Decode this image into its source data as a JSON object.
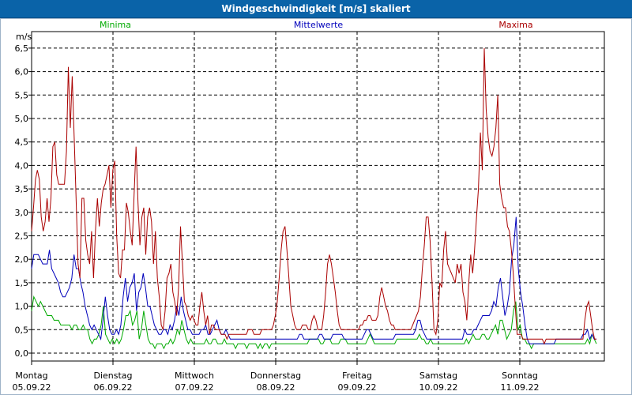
{
  "window": {
    "title": "Windgeschwindigkeit [m/s] skaliert"
  },
  "chart_data": {
    "type": "line",
    "title": "Windgeschwindigkeit [m/s] skaliert",
    "ylabel": "m/s",
    "ylim": [
      -0.15,
      6.7
    ],
    "y_ticks": [
      "0,0",
      "0,5",
      "1,0",
      "1,5",
      "2,0",
      "2,5",
      "3,0",
      "3,5",
      "4,0",
      "4,5",
      "5,0",
      "5,5",
      "6,0",
      "6,5"
    ],
    "y_tick_values": [
      0,
      0.5,
      1,
      1.5,
      2,
      2.5,
      3,
      3.5,
      4,
      4.5,
      5,
      5.5,
      6,
      6.5
    ],
    "x_categories": [
      {
        "day": "Montag",
        "date": "05.09.22"
      },
      {
        "day": "Dienstag",
        "date": "06.09.22"
      },
      {
        "day": "Mittwoch",
        "date": "07.09.22"
      },
      {
        "day": "Donnerstag",
        "date": "08.09.22"
      },
      {
        "day": "Freitag",
        "date": "09.09.22"
      },
      {
        "day": "Samstag",
        "date": "10.09.22"
      },
      {
        "day": "Sonntag",
        "date": "11.09.22"
      }
    ],
    "grid": true,
    "legend_position": "top",
    "series": [
      {
        "name": "Minima",
        "color": "#00aa00",
        "values": [
          0.9,
          1.2,
          1.1,
          1.0,
          1.1,
          1.0,
          0.9,
          0.8,
          0.8,
          0.8,
          0.7,
          0.7,
          0.7,
          0.6,
          0.6,
          0.6,
          0.6,
          0.6,
          0.5,
          0.6,
          0.6,
          0.5,
          0.5,
          0.6,
          0.5,
          0.5,
          0.3,
          0.2,
          0.3,
          0.3,
          0.4,
          0.6,
          1.0,
          0.4,
          0.3,
          0.2,
          0.3,
          0.2,
          0.3,
          0.2,
          0.3,
          0.5,
          0.8,
          0.8,
          0.9,
          0.6,
          0.7,
          0.9,
          0.3,
          0.5,
          0.9,
          0.6,
          0.3,
          0.2,
          0.2,
          0.1,
          0.2,
          0.2,
          0.2,
          0.1,
          0.2,
          0.2,
          0.3,
          0.2,
          0.3,
          0.5,
          0.4,
          0.7,
          0.5,
          0.3,
          0.2,
          0.3,
          0.2,
          0.2,
          0.2,
          0.2,
          0.2,
          0.2,
          0.3,
          0.2,
          0.2,
          0.3,
          0.3,
          0.2,
          0.2,
          0.2,
          0.3,
          0.2,
          0.2,
          0.2,
          0.2,
          0.1,
          0.2,
          0.2,
          0.2,
          0.2,
          0.1,
          0.2,
          0.2,
          0.2,
          0.2,
          0.1,
          0.2,
          0.1,
          0.2,
          0.2,
          0.1,
          0.2,
          0.2,
          0.2,
          0.2,
          0.2,
          0.2,
          0.2,
          0.2,
          0.2,
          0.2,
          0.2,
          0.2,
          0.2,
          0.2,
          0.2,
          0.2,
          0.2,
          0.3,
          0.3,
          0.3,
          0.3,
          0.3,
          0.2,
          0.2,
          0.3,
          0.3,
          0.3,
          0.2,
          0.2,
          0.2,
          0.2,
          0.3,
          0.3,
          0.3,
          0.2,
          0.2,
          0.2,
          0.2,
          0.2,
          0.2,
          0.2,
          0.2,
          0.2,
          0.3,
          0.4,
          0.3,
          0.2,
          0.2,
          0.2,
          0.2,
          0.2,
          0.2,
          0.2,
          0.2,
          0.2,
          0.2,
          0.3,
          0.3,
          0.3,
          0.3,
          0.3,
          0.3,
          0.3,
          0.3,
          0.3,
          0.3,
          0.4,
          0.3,
          0.3,
          0.2,
          0.2,
          0.3,
          0.2,
          0.2,
          0.2,
          0.2,
          0.2,
          0.2,
          0.2,
          0.2,
          0.2,
          0.2,
          0.2,
          0.2,
          0.2,
          0.2,
          0.2,
          0.3,
          0.2,
          0.3,
          0.4,
          0.3,
          0.3,
          0.3,
          0.4,
          0.4,
          0.3,
          0.3,
          0.4,
          0.5,
          0.6,
          0.4,
          0.7,
          0.7,
          0.5,
          0.3,
          0.4,
          0.5,
          0.9,
          1.1,
          0.5,
          0.6,
          0.3,
          0.3,
          0.2,
          0.2,
          0.1,
          0.2,
          0.2,
          0.2,
          0.2,
          0.2,
          0.2,
          0.2,
          0.2,
          0.2,
          0.2,
          0.2,
          0.2,
          0.2,
          0.2,
          0.2,
          0.2,
          0.2,
          0.2,
          0.2,
          0.2,
          0.2,
          0.2,
          0.2,
          0.2,
          0.3,
          0.2,
          0.4,
          0.3,
          0.2
        ]
      },
      {
        "name": "Mittelwerte",
        "color": "#0000bb",
        "values": [
          1.8,
          2.1,
          2.1,
          2.1,
          2.0,
          1.9,
          1.9,
          1.9,
          2.2,
          1.8,
          1.7,
          1.6,
          1.5,
          1.3,
          1.2,
          1.2,
          1.3,
          1.4,
          1.6,
          2.1,
          1.8,
          1.8,
          1.5,
          1.3,
          1.0,
          0.8,
          0.6,
          0.5,
          0.6,
          0.5,
          0.4,
          0.3,
          0.7,
          1.2,
          0.8,
          0.5,
          0.4,
          0.4,
          0.5,
          0.4,
          0.6,
          1.2,
          1.6,
          1.1,
          1.4,
          1.5,
          1.7,
          0.9,
          1.3,
          1.4,
          1.7,
          1.4,
          1.0,
          1.0,
          0.8,
          0.6,
          0.5,
          0.4,
          0.4,
          0.5,
          0.5,
          0.4,
          0.6,
          0.5,
          0.7,
          1.0,
          0.8,
          1.2,
          0.9,
          0.7,
          0.5,
          0.5,
          0.4,
          0.4,
          0.4,
          0.4,
          0.5,
          0.5,
          0.6,
          0.4,
          0.4,
          0.5,
          0.6,
          0.7,
          0.5,
          0.4,
          0.4,
          0.5,
          0.4,
          0.3,
          0.3,
          0.3,
          0.3,
          0.3,
          0.3,
          0.3,
          0.3,
          0.3,
          0.3,
          0.3,
          0.3,
          0.3,
          0.3,
          0.3,
          0.3,
          0.3,
          0.3,
          0.3,
          0.3,
          0.3,
          0.3,
          0.3,
          0.3,
          0.3,
          0.3,
          0.3,
          0.3,
          0.3,
          0.3,
          0.3,
          0.4,
          0.4,
          0.3,
          0.3,
          0.3,
          0.3,
          0.3,
          0.3,
          0.3,
          0.4,
          0.4,
          0.3,
          0.3,
          0.3,
          0.3,
          0.4,
          0.4,
          0.4,
          0.4,
          0.4,
          0.3,
          0.3,
          0.3,
          0.3,
          0.3,
          0.3,
          0.3,
          0.3,
          0.3,
          0.4,
          0.5,
          0.5,
          0.4,
          0.3,
          0.3,
          0.3,
          0.3,
          0.3,
          0.3,
          0.3,
          0.3,
          0.3,
          0.3,
          0.4,
          0.4,
          0.4,
          0.4,
          0.4,
          0.4,
          0.4,
          0.4,
          0.4,
          0.5,
          0.7,
          0.7,
          0.5,
          0.4,
          0.3,
          0.3,
          0.3,
          0.3,
          0.3,
          0.3,
          0.3,
          0.3,
          0.3,
          0.3,
          0.3,
          0.3,
          0.3,
          0.3,
          0.3,
          0.3,
          0.3,
          0.5,
          0.4,
          0.4,
          0.4,
          0.5,
          0.5,
          0.6,
          0.7,
          0.8,
          0.8,
          0.8,
          0.8,
          0.9,
          1.1,
          1.0,
          1.4,
          1.6,
          1.2,
          0.8,
          1.0,
          1.3,
          2.0,
          2.3,
          2.9,
          1.8,
          1.3,
          1.0,
          0.6,
          0.3,
          0.2,
          0.2,
          0.2,
          0.2,
          0.2,
          0.2,
          0.2,
          0.2,
          0.2,
          0.2,
          0.2,
          0.2,
          0.3,
          0.3,
          0.3,
          0.3,
          0.3,
          0.3,
          0.3,
          0.3,
          0.3,
          0.3,
          0.3,
          0.3,
          0.4,
          0.4,
          0.5,
          0.3,
          0.4,
          0.3,
          0.3
        ]
      },
      {
        "name": "Maxima",
        "color": "#aa0000",
        "values": [
          2.6,
          3.1,
          3.7,
          3.9,
          3.7,
          2.9,
          2.6,
          2.8,
          3.3,
          2.8,
          3.3,
          4.4,
          4.5,
          3.8,
          3.6,
          3.6,
          3.6,
          3.6,
          4.3,
          6.1,
          4.8,
          5.9,
          4.6,
          3.3,
          1.9,
          1.6,
          3.3,
          3.3,
          2.4,
          2.1,
          1.9,
          2.6,
          1.6,
          2.6,
          3.3,
          2.7,
          3.2,
          3.5,
          3.6,
          3.8,
          4.0,
          3.1,
          3.9,
          4.1,
          2.5,
          1.7,
          1.6,
          2.2,
          2.2,
          3.2,
          3.0,
          2.6,
          2.3,
          3.4,
          4.4,
          3.2,
          2.3,
          2.9,
          3.1,
          2.1,
          2.9,
          3.1,
          2.8,
          1.9,
          2.6,
          1.6,
          1.2,
          0.6,
          0.5,
          0.9,
          1.6,
          1.7,
          1.9,
          1.3,
          1.1,
          0.8,
          1.4,
          2.7,
          1.9,
          1.1,
          1.0,
          0.8,
          0.7,
          0.8,
          0.7,
          0.6,
          0.6,
          1.0,
          1.3,
          0.9,
          0.6,
          0.8,
          0.4,
          0.6,
          0.6,
          0.5,
          0.5,
          0.5,
          0.4,
          0.4,
          0.4,
          0.3,
          0.4,
          0.4,
          0.4,
          0.4,
          0.4,
          0.4,
          0.4,
          0.4,
          0.4,
          0.4,
          0.5,
          0.5,
          0.5,
          0.4,
          0.4,
          0.4,
          0.4,
          0.5,
          0.5,
          0.5,
          0.5,
          0.5,
          0.5,
          0.6,
          0.8,
          1.1,
          1.6,
          2.2,
          2.6,
          2.7,
          2.2,
          1.6,
          1.0,
          0.8,
          0.6,
          0.5,
          0.5,
          0.5,
          0.6,
          0.6,
          0.6,
          0.5,
          0.5,
          0.7,
          0.8,
          0.7,
          0.5,
          0.5,
          0.5,
          0.8,
          1.3,
          1.9,
          2.1,
          1.9,
          1.6,
          1.3,
          0.9,
          0.6,
          0.5,
          0.5,
          0.5,
          0.5,
          0.5,
          0.5,
          0.5,
          0.5,
          0.5,
          0.5,
          0.6,
          0.6,
          0.7,
          0.7,
          0.8,
          0.8,
          0.7,
          0.7,
          0.7,
          0.8,
          1.2,
          1.4,
          1.2,
          1.0,
          0.9,
          0.7,
          0.6,
          0.6,
          0.5,
          0.5,
          0.5,
          0.5,
          0.5,
          0.5,
          0.5,
          0.5,
          0.5,
          0.6,
          0.7,
          0.8,
          0.9,
          1.2,
          1.8,
          2.3,
          2.9,
          2.9,
          2.4,
          1.5,
          0.5,
          0.4,
          0.7,
          1.5,
          1.4,
          2.2,
          2.6,
          1.9,
          1.8,
          1.7,
          1.6,
          1.5,
          1.9,
          1.7,
          1.9,
          1.3,
          1.1,
          0.7,
          1.5,
          2.1,
          1.7,
          2.2,
          2.9,
          3.5,
          4.7,
          3.9,
          6.5,
          5.2,
          4.6,
          4.3,
          4.2,
          4.4,
          4.8,
          5.5,
          3.6,
          3.3,
          3.1,
          3.1,
          2.7,
          2.6,
          2.2,
          1.7,
          1.0,
          0.4,
          0.4,
          0.4,
          0.3,
          0.3,
          0.3,
          0.3,
          0.3,
          0.3,
          0.3,
          0.3,
          0.3,
          0.3,
          0.3,
          0.2,
          0.3,
          0.3,
          0.3,
          0.3,
          0.3,
          0.3,
          0.3,
          0.3,
          0.3,
          0.3,
          0.3,
          0.3,
          0.3,
          0.3,
          0.3,
          0.3,
          0.3,
          0.3,
          0.3,
          0.3,
          0.7,
          1.0,
          1.1,
          0.8,
          0.5,
          0.3,
          0.3
        ]
      }
    ]
  }
}
